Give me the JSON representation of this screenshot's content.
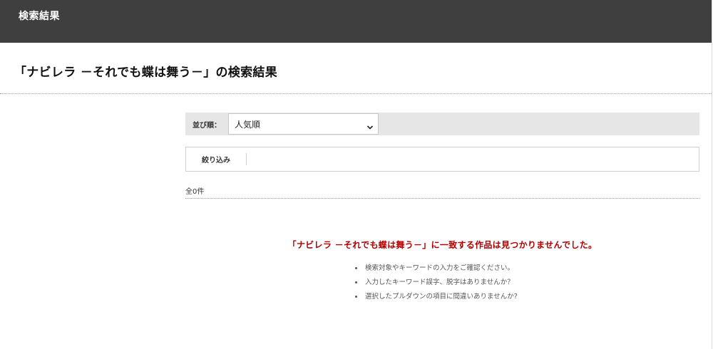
{
  "header": {
    "title": "検索結果"
  },
  "search": {
    "heading": "「ナビレラ －それでも蝶は舞う－」の検索結果"
  },
  "sort": {
    "label": "並び順：",
    "selected": "人気順"
  },
  "filter": {
    "label": "絞り込み"
  },
  "results": {
    "count_text": "全0件",
    "no_results_message": "「ナビレラ －それでも蝶は舞う－」に一致する作品は見つかりませんでした。",
    "hints": [
      "検索対象やキーワードの入力をご確認ください。",
      "入力したキーワード誤字、脱字はありませんか？",
      "選択したプルダウンの項目に間違いありませんか?"
    ]
  },
  "icons": {
    "sort_chevron": "chevron-down-icon"
  }
}
